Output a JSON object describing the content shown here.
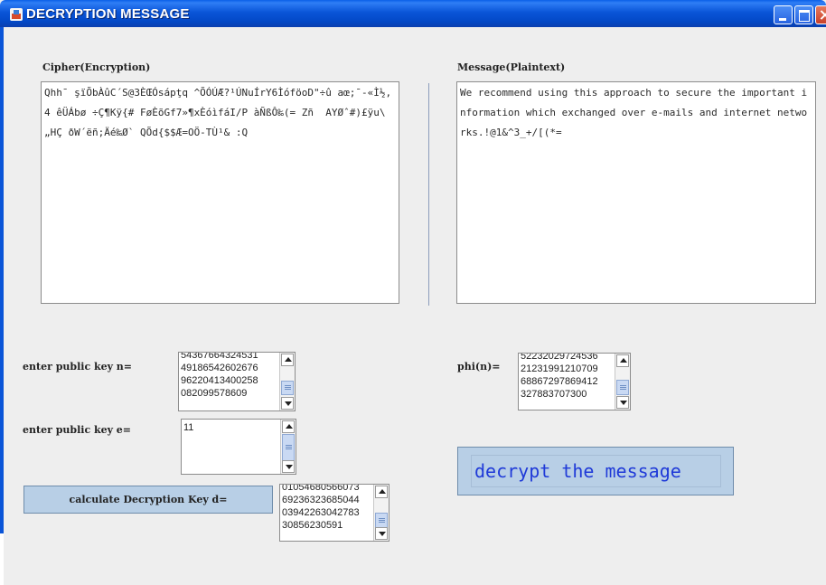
{
  "window": {
    "title": "DECRYPTION MESSAGE"
  },
  "cipher": {
    "label": "Cipher(Encryption)",
    "text": "Qhh¯ şïÕbÀûC´S@3ÈŒÓsápţq ^ÕÓÚÆ?¹ÚNuÍrY6ÌóföoD\"÷û aœ;¯-«Ì½,4 êÜÁbø ÷Ç¶Kÿ{# FøÈõGf7»¶xÈóìfáI/P àÑßÔ‰(= Zñ  AYØˆ#)£ÿu\\„HÇ ðW´ëñ;Äé‰Ø` QÕd{$$Æ=OÖ-TÙ¹& :Q"
  },
  "message": {
    "label": "Message(Plaintext)",
    "text": "We recommend using this approach to secure the important information which exchanged over e-mails and internet networks.!@1&^3_+/[(*="
  },
  "public_key_n": {
    "label": "enter public key n=",
    "lines": [
      "54367664324531",
      "49186542602676",
      "96220413400258",
      "082099578609"
    ]
  },
  "public_key_e": {
    "label": "enter public key e=",
    "value": "11"
  },
  "phi_n": {
    "label": "phi(n)=",
    "lines": [
      "52232029724536",
      "21231991210709",
      "68867297869412",
      "327883707300"
    ]
  },
  "calc_button": {
    "label": "calculate Decryption Key d="
  },
  "key_d": {
    "lines": [
      "01054680566073",
      "69236323685044",
      "03942263042783",
      "30856230591"
    ]
  },
  "decrypt_button": {
    "label": "decrypt the message"
  },
  "colors": {
    "titlebar": "#0a55d8",
    "decrypt_text": "#1f3ad8",
    "button_bg": "#b8cfe6"
  }
}
